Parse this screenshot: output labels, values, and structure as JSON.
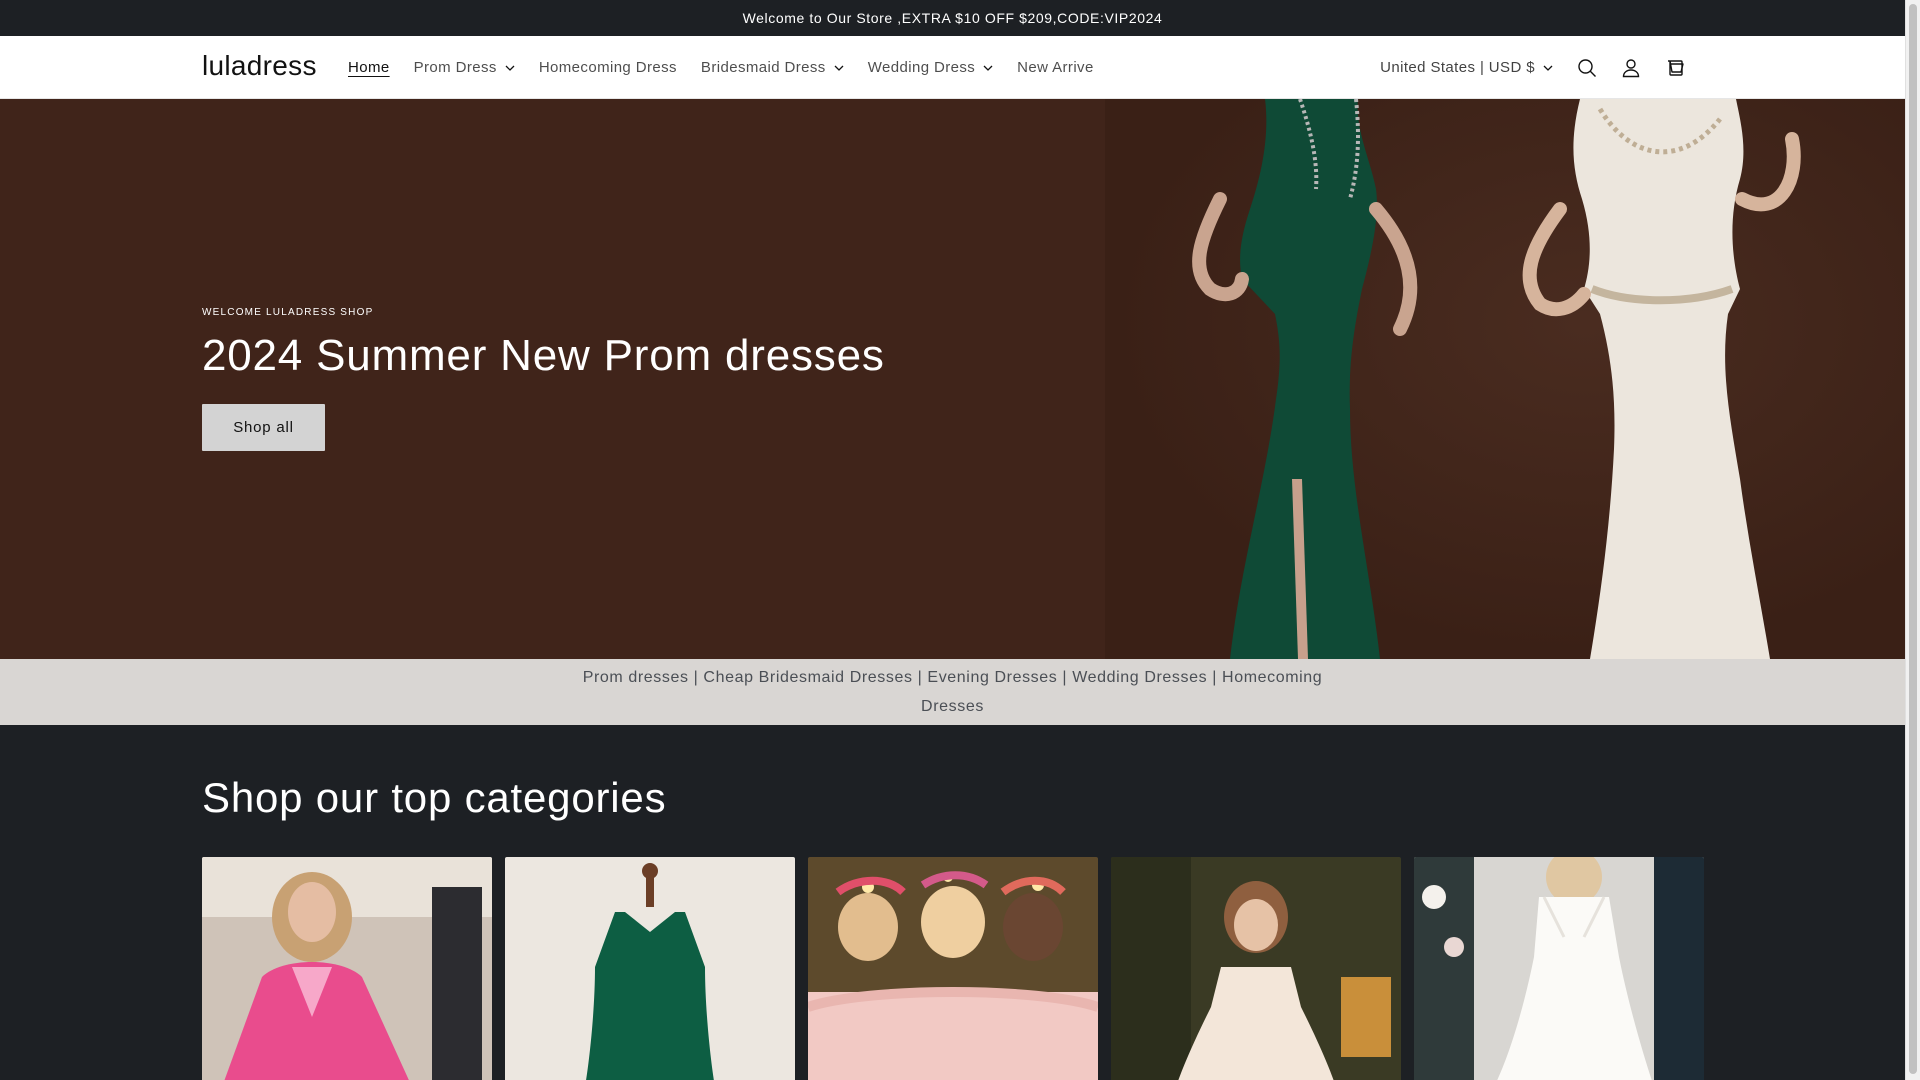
{
  "announcement": {
    "text": "Welcome to Our Store ,EXTRA $10 OFF $209,CODE:VIP2024"
  },
  "header": {
    "logo": "luladress",
    "nav": [
      {
        "label": "Home",
        "active": true,
        "dropdown": false
      },
      {
        "label": "Prom Dress",
        "active": false,
        "dropdown": true
      },
      {
        "label": "Homecoming Dress",
        "active": false,
        "dropdown": false
      },
      {
        "label": "Bridesmaid Dress",
        "active": false,
        "dropdown": true
      },
      {
        "label": "Wedding Dress",
        "active": false,
        "dropdown": true
      },
      {
        "label": "New Arrive",
        "active": false,
        "dropdown": false
      }
    ],
    "currency": "United States | USD $",
    "icons": [
      "search-icon",
      "account-icon",
      "cart-icon"
    ]
  },
  "hero": {
    "subheading": "WELCOME LULADRESS SHOP",
    "title": "2024 Summer New Prom dresses",
    "button": "Shop all"
  },
  "linkbar": {
    "text": "Prom dresses | Cheap Bridesmaid Dresses | Evening Dresses | Wedding Dresses | Homecoming Dresses"
  },
  "categories": {
    "title": "Shop our top categories",
    "cards": [
      {
        "subject": "pink sequin prom dress"
      },
      {
        "subject": "green halter dress on mannequin"
      },
      {
        "subject": "blush off-shoulder bridesmaid dresses"
      },
      {
        "subject": "flower girl dress with floral crown"
      },
      {
        "subject": "white lace wedding dress"
      }
    ]
  },
  "colors": {
    "hero_bg": "#40241a",
    "dark_bg": "#1d2024",
    "linkbar_bg": "#d9d6d3",
    "button_bg": "#d3d3d3"
  }
}
